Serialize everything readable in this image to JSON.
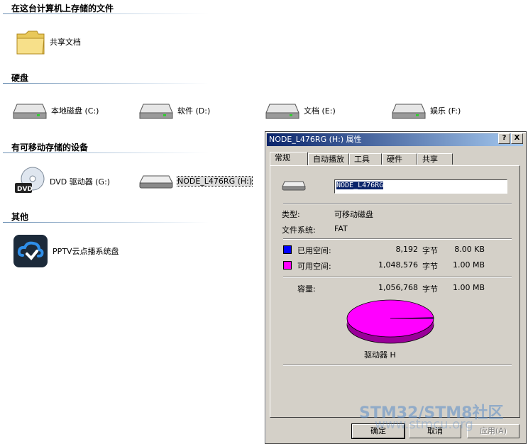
{
  "sections": {
    "stored": "在这台计算机上存储的文件",
    "disks": "硬盘",
    "removable": "有可移动存储的设备",
    "other": "其他"
  },
  "items": {
    "shared_docs": "共享文档",
    "local_c": "本地磁盘 (C:)",
    "soft_d": "软件 (D:)",
    "docs_e": "文档 (E:)",
    "ent_f": "娱乐 (F:)",
    "dvd_g": "DVD 驱动器 (G:)",
    "node_h": "NODE_L476RG (H:)",
    "pptv": "PPTV云点播系统盘"
  },
  "dialog": {
    "title": "NODE_L476RG (H:) 属性",
    "help_btn": "?",
    "close_btn": "X",
    "tabs": [
      "常规",
      "自动播放",
      "工具",
      "硬件",
      "共享"
    ],
    "name_value": "NODE_L476RG",
    "type_label": "类型:",
    "type_value": "可移动磁盘",
    "fs_label": "文件系统:",
    "fs_value": "FAT",
    "used_label": "已用空间:",
    "used_bytes": "8,192",
    "used_unit": "字节",
    "used_size": "8.00 KB",
    "free_label": "可用空间:",
    "free_bytes": "1,048,576",
    "free_unit": "字节",
    "free_size": "1.00 MB",
    "cap_label": "容量:",
    "cap_bytes": "1,056,768",
    "cap_unit": "字节",
    "cap_size": "1.00 MB",
    "drive_label": "驱动器 H",
    "ok": "确定",
    "cancel": "取消",
    "apply": "应用(A)"
  },
  "pie": {
    "used_fraction": 0.0078,
    "used_color": "#0000ff",
    "free_color": "#ff00ff"
  },
  "watermark": {
    "line1": "STM32/STM8社区",
    "line2": "www.stmcu.org"
  }
}
